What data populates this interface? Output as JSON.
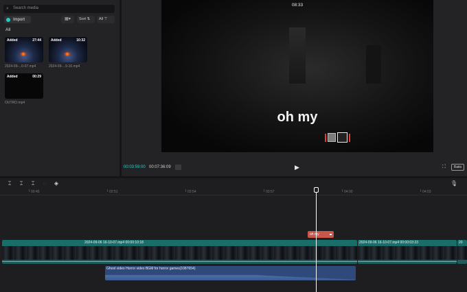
{
  "media": {
    "search_placeholder": "Search media",
    "import_label": "Import",
    "view_label": "▦▾",
    "sort_label": "Sort",
    "filter_label": "All",
    "section_all": "All",
    "items": [
      {
        "tag": "Added",
        "duration": "27:44",
        "name": "2024-09-...0-07.mp4"
      },
      {
        "tag": "Added",
        "duration": "10:32",
        "name": "2024-09-...9-16.mp4"
      },
      {
        "tag": "Added",
        "duration": "00:29",
        "name": "OUTRO.mp4"
      }
    ]
  },
  "player": {
    "video_time": "08:33",
    "caption": "oh my",
    "current_tc": "00:03:59:00",
    "total_tc": "00:07:36:09",
    "ratio_label": "Ratio"
  },
  "timeline": {
    "ruler": [
      "00:45",
      "02:51",
      "03:54",
      "03:57",
      "04:00",
      "04:03"
    ],
    "text_clip": "oh my",
    "video_clips": [
      {
        "label": "2024-09-06 16-10-07.mp4  00:00:10:18"
      },
      {
        "label": "2024-09-06 16-10-07.mp4  00:00:03:23"
      },
      {
        "label": "20"
      }
    ],
    "audio_clip": "Ghost video Horror video BGM for horror games(1087654)"
  },
  "colors": {
    "accent": "#1fd0c3",
    "text_clip": "#c8564a",
    "audio_clip": "#2f4a7a",
    "video_header": "#1a6e6a"
  }
}
